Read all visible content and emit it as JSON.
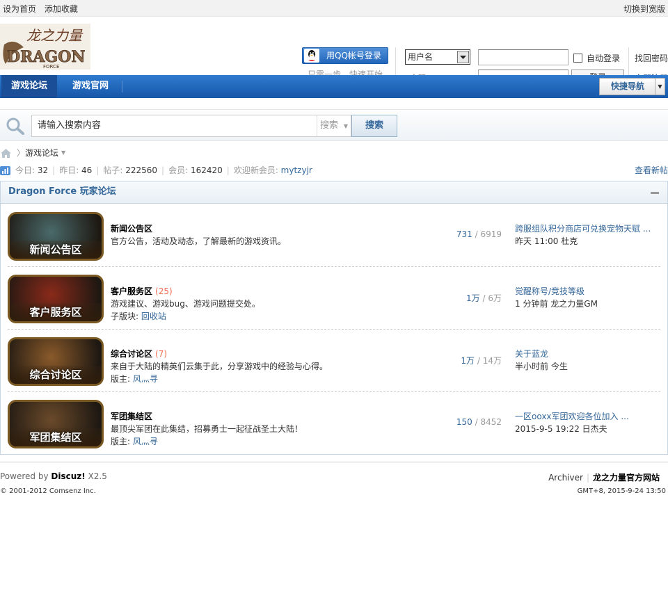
{
  "topbar": {
    "set_home": "设为首页",
    "add_favorite": "添加收藏",
    "switch_width": "切换到宽版"
  },
  "header": {
    "logo_text": "龙之力量 DRAGON FORCE",
    "qq_login": "用QQ帐号登录",
    "qq_tip": "只需一步，快速开始",
    "username_select": "用户名",
    "password_label": "密码",
    "auto_login": "自动登录",
    "login_button": "登录",
    "find_password": "找回密码",
    "register": "立即注册"
  },
  "nav": {
    "tabs": [
      {
        "label": "游戏论坛"
      },
      {
        "label": "游戏官网"
      }
    ],
    "quick_nav": "快捷导航"
  },
  "search": {
    "placeholder": "请输入搜索内容",
    "type_label": "搜索",
    "button": "搜索"
  },
  "breadcrumb": {
    "current": "游戏论坛"
  },
  "stats": {
    "today_label": "今日: ",
    "today": "32",
    "yesterday_label": "昨日: ",
    "yesterday": "46",
    "posts_label": "帖子: ",
    "posts": "222560",
    "members_label": "会员: ",
    "members": "162420",
    "newest_label": "欢迎新会员: ",
    "newest_member": "mytzyjr",
    "view_new": "查看新帖"
  },
  "forum": {
    "title": "Dragon Force 玩家论坛",
    "rows": [
      {
        "thumb_caption": "新闻公告区",
        "name": "新闻公告区",
        "today": "",
        "desc": "官方公告，活动及动态，了解最新的游戏资讯。",
        "sub_label": "",
        "sub_value": "",
        "threads": "731",
        "posts": "6919",
        "last_title": "跨服组队积分商店可兑换宠物天赋 ...",
        "last_meta": "昨天 11:00 杜克",
        "thumb_color": "#4a6a6a"
      },
      {
        "thumb_caption": "客户服务区",
        "name": "客户服务区",
        "today": "(25)",
        "desc": "游戏建议、游戏bug、游戏问题提交处。",
        "sub_label": "子版块: ",
        "sub_value": "回收站",
        "threads": "1万",
        "posts": "6万",
        "last_title": "觉醒称号/竞技等级",
        "last_meta": "1 分钟前 龙之力量GM",
        "thumb_color": "#8a2a1a"
      },
      {
        "thumb_caption": "综合讨论区",
        "name": "综合讨论区",
        "today": "(7)",
        "desc": "来自于大陆的精英们云集于此，分享游戏中的经验与心得。",
        "sub_label": "版主: ",
        "sub_value": "风灬寻",
        "threads": "1万",
        "posts": "14万",
        "last_title": "关于蓝龙",
        "last_meta": "半小时前 今生",
        "thumb_color": "#8a5a2a"
      },
      {
        "thumb_caption": "军团集结区",
        "name": "军团集结区",
        "today": "",
        "desc": "最顶尖军团在此集结，招募勇士一起征战圣土大陆！",
        "sub_label": "版主: ",
        "sub_value": "风灬寻",
        "threads": "150",
        "posts": "8452",
        "last_title": "一区ooxx军团欢迎各位加入 ...",
        "last_meta": "2015-9-5 19:22 日杰夫",
        "thumb_color": "#6a4a2a"
      }
    ]
  },
  "footer": {
    "powered_prefix": "Powered by ",
    "powered_brand": "Discuz!",
    "powered_version": " X2.5",
    "copyright": "© 2001-2012 Comsenz Inc.",
    "archiver": "Archiver",
    "site_name": "龙之力量官方网站",
    "gmt": "GMT+8, 2015-9-24 13:50"
  }
}
